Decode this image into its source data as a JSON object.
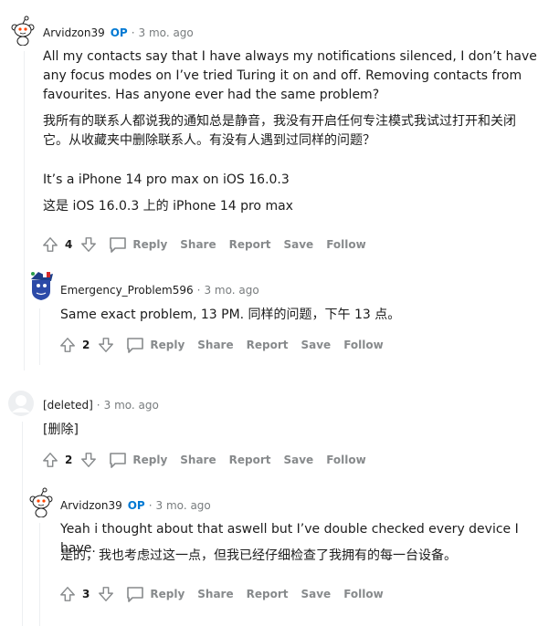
{
  "comments": [
    {
      "author": "Arvidzon39",
      "op_badge": "OP",
      "separator": "·",
      "age": "3 mo. ago",
      "body": [
        "All my contacts say that I have always my notifications silenced, I don’t have any focus modes on I’ve tried Turing it on and off. Removing contacts from favourites. Has anyone ever had the same problem?",
        "我所有的联系人都说我的通知总是静音，我没有开启任何专注模式我试过打开和关闭它。从收藏夹中删除联系人。有没有人遇到过同样的问题？",
        "It’s a iPhone 14 pro max on iOS 16.0.3",
        "这是 iOS 16.0.3 上的 iPhone 14 pro max"
      ],
      "score": "4",
      "actions": {
        "reply": "Reply",
        "share": "Share",
        "report": "Report",
        "save": "Save",
        "follow": "Follow"
      }
    },
    {
      "author": "Emergency_Problem596",
      "separator": "·",
      "age": "3 mo. ago",
      "body": [
        "Same exact problem, 13 PM. 同样的问题，下午 13 点。"
      ],
      "score": "2",
      "actions": {
        "reply": "Reply",
        "share": "Share",
        "report": "Report",
        "save": "Save",
        "follow": "Follow"
      }
    },
    {
      "author": "[deleted]",
      "separator": "·",
      "age": "3 mo. ago",
      "body": [
        "[删除]"
      ],
      "score": "2",
      "actions": {
        "reply": "Reply",
        "share": "Share",
        "report": "Report",
        "save": "Save",
        "follow": "Follow"
      }
    },
    {
      "author": "Arvidzon39",
      "op_badge": "OP",
      "separator": "·",
      "age": "3 mo. ago",
      "body": [
        "Yeah i thought about that aswell but I’ve double checked every device I have.",
        "是的，我也考虑过这一点，但我已经仔细检查了我拥有的每一台设备。"
      ],
      "score": "3",
      "actions": {
        "reply": "Reply",
        "share": "Share",
        "report": "Report",
        "save": "Save",
        "follow": "Follow"
      }
    }
  ],
  "colors": {
    "op": "#0079d3",
    "meta": "#787c7e",
    "action": "#878a8c",
    "thread": "#edeff1"
  }
}
